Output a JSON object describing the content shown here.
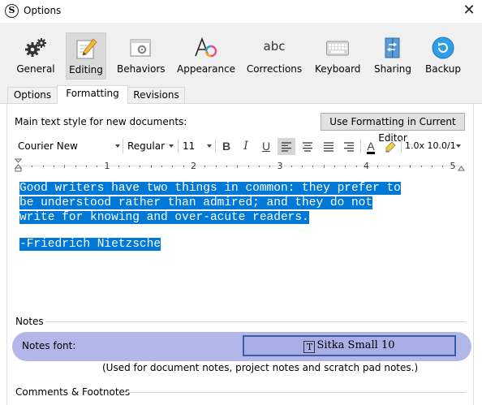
{
  "window": {
    "title": "Options",
    "app_icon": "S"
  },
  "toolbar": {
    "items": [
      {
        "label": "General",
        "icon": "gears-icon"
      },
      {
        "label": "Editing",
        "icon": "pencil-icon",
        "active": true
      },
      {
        "label": "Behaviors",
        "icon": "window-gear-icon"
      },
      {
        "label": "Appearance",
        "icon": "font-color-icon"
      },
      {
        "label": "Corrections",
        "icon": "abc-icon",
        "icon_text": "abc"
      },
      {
        "label": "Keyboard",
        "icon": "keyboard-icon"
      },
      {
        "label": "Sharing",
        "icon": "sharing-icon"
      },
      {
        "label": "Backup",
        "icon": "backup-icon"
      }
    ]
  },
  "tabs": [
    {
      "label": "Options"
    },
    {
      "label": "Formatting",
      "active": true
    },
    {
      "label": "Revisions"
    }
  ],
  "formatting": {
    "main_style_label": "Main text style for new documents:",
    "use_button": "Use Formatting in Current Editor",
    "font_family": "Courier New",
    "font_style": "Regular",
    "font_size": "11",
    "bold": "B",
    "italic": "I",
    "underline": "U",
    "text_color_glyph": "A",
    "spacing": "1.0x 10.0/1",
    "ruler_numbers": [
      "1",
      "2",
      "3",
      "4",
      "5"
    ]
  },
  "sample_text": {
    "quote_lines": [
      "Good writers have two things in common: they prefer to",
      "be understood rather than admired; and they do not",
      "write for knowing and over-acute readers."
    ],
    "attribution": "-Friedrich Nietzsche"
  },
  "notes": {
    "section_title": "Notes",
    "font_label": "Notes font:",
    "font_button": "Sitka Small 10",
    "hint": "(Used for document notes, project notes and scratch pad notes.)"
  },
  "comments": {
    "section_title": "Comments & Footnotes"
  },
  "colors": {
    "highlight": "#0078d7",
    "notes_band": "#b3b6e8",
    "notes_button_border": "#3a5ea8",
    "text_color_underline": "#000000"
  }
}
